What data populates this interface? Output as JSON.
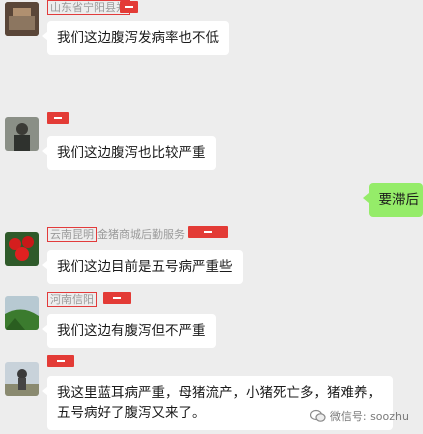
{
  "messages": [
    {
      "name": "山东省宁阳县郑",
      "text": "我们这边腹泻发病率也不低"
    },
    {
      "name": "",
      "text": "我们这边腹泻也比较严重"
    },
    {
      "self_text": "要滞后"
    },
    {
      "name_boxed": "云南昆明",
      "name_rest": "金猪商城后勤服务",
      "text": "我们这边目前是五号病严重些"
    },
    {
      "name_boxed": "河南信阳",
      "text": "我们这边有腹泻但不严重"
    },
    {
      "name": "",
      "text": "我这里蓝耳病严重，母猪流产，小猪死亡多，猪难养，五号病好了腹泻又来了。"
    }
  ],
  "watermark": {
    "icon": "wechat-icon",
    "text": "微信号: soozhu"
  }
}
